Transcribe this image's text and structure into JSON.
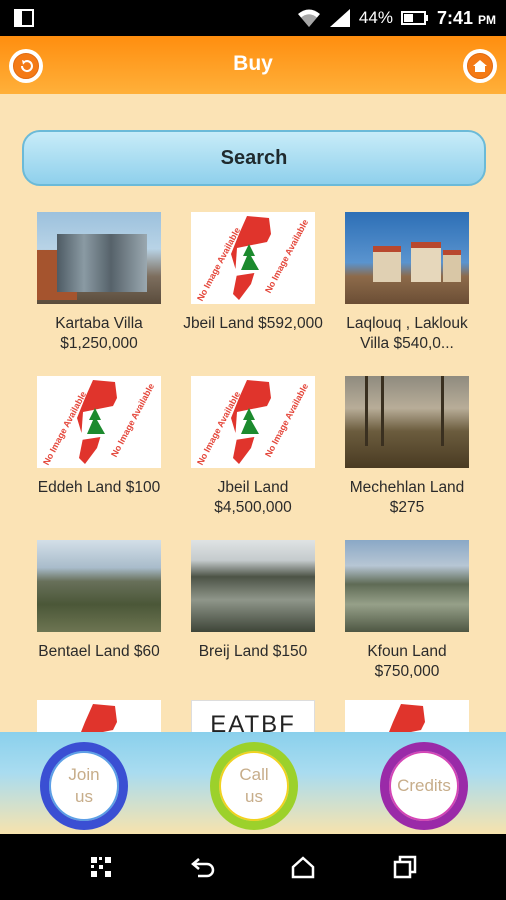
{
  "status_bar": {
    "wifi_icon": "wifi-icon",
    "signal_icon": "signal-icon",
    "battery_percent": "44%",
    "battery_icon": "battery-icon",
    "time": "7:41",
    "ampm": "PM"
  },
  "header": {
    "title": "Buy",
    "back_icon": "back-arrow-icon",
    "home_icon": "home-icon",
    "accent": "#ff8e0f"
  },
  "search": {
    "label": "Search"
  },
  "listings": [
    {
      "caption": "Kartaba Villa $1,250,000",
      "line1": "Kartaba Villa",
      "line2": "$1,250,000"
    },
    {
      "caption": "Jbeil Land $592,000",
      "line1": "Jbeil Land $592,000",
      "line2": ""
    },
    {
      "caption": "Laqlouq , Laklouk Villa $540,0...",
      "line1": "Laqlouq , Laklouk",
      "line2": "Villa $540,0..."
    },
    {
      "caption": "Eddeh Land $100",
      "line1": "Eddeh Land $100",
      "line2": ""
    },
    {
      "caption": "Jbeil Land $4,500,000",
      "line1": "Jbeil Land",
      "line2": "$4,500,000"
    },
    {
      "caption": "Mechehlan Land $275",
      "line1": "Mechehlan Land",
      "line2": "$275"
    },
    {
      "caption": "Bentael Land $60",
      "line1": "Bentael Land $60",
      "line2": ""
    },
    {
      "caption": "Breij Land $150",
      "line1": "Breij Land $150",
      "line2": ""
    },
    {
      "caption": "Kfoun Land $750,000",
      "line1": "Kfoun Land",
      "line2": "$750,000"
    }
  ],
  "no_image_watermark": "No Image Available",
  "partial_tile_text": "EATBF",
  "bottom_buttons": {
    "join_line1": "Join",
    "join_line2": "us",
    "call_line1": "Call",
    "call_line2": "us",
    "credits": "Credits"
  },
  "nav": {
    "qr_icon": "qr-code-icon",
    "back_icon": "nav-back-icon",
    "home_icon": "nav-home-icon",
    "recents_icon": "nav-recents-icon"
  }
}
